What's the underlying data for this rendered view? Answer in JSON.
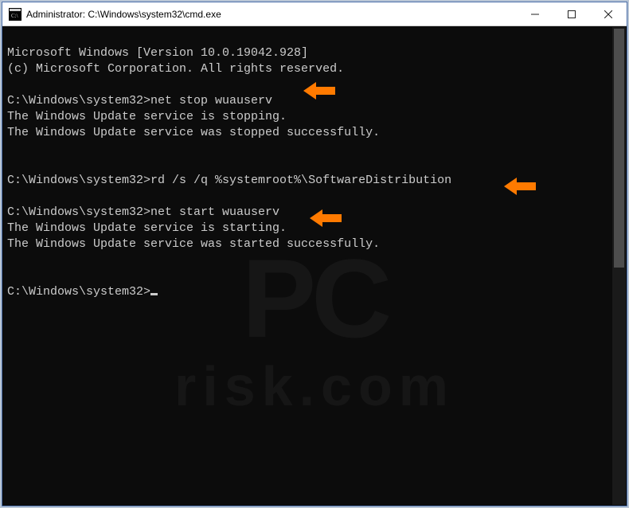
{
  "window": {
    "title": "Administrator: C:\\Windows\\system32\\cmd.exe"
  },
  "console": {
    "header1": "Microsoft Windows [Version 10.0.19042.928]",
    "header2": "(c) Microsoft Corporation. All rights reserved.",
    "prompt": "C:\\Windows\\system32>",
    "cmd1": "net stop wuauserv",
    "out1a": "The Windows Update service is stopping.",
    "out1b": "The Windows Update service was stopped successfully.",
    "cmd2": "rd /s /q %systemroot%\\SoftwareDistribution",
    "cmd3": "net start wuauserv",
    "out3a": "The Windows Update service is starting.",
    "out3b": "The Windows Update service was started successfully."
  },
  "watermark": {
    "line1": "PC",
    "line2": "risk.com"
  },
  "annotations": {
    "arrow_color": "#ff7a00"
  }
}
